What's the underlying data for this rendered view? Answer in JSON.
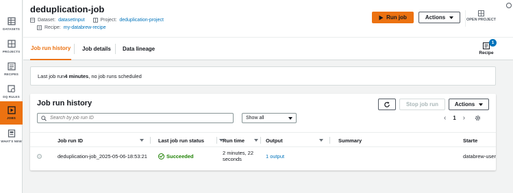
{
  "sidebar": {
    "items": [
      {
        "label": "DATASETS",
        "icon": "table-icon",
        "active": false
      },
      {
        "label": "PROJECTS",
        "icon": "grid-icon",
        "active": false
      },
      {
        "label": "RECIPES",
        "icon": "list-icon",
        "active": false
      },
      {
        "label": "DQ RULES",
        "icon": "shield-check-icon",
        "active": false
      },
      {
        "label": "JOBS",
        "icon": "play-icon",
        "active": true
      },
      {
        "label": "WHAT'S NEW",
        "icon": "news-icon",
        "active": false
      }
    ]
  },
  "header": {
    "title": "deduplication-job",
    "dataset_label": "Dataset:",
    "dataset_value": "datasetInput",
    "project_label": "Project:",
    "project_value": "deduplication-project",
    "recipe_label": "Recipe:",
    "recipe_value": "my-databrew-recipe",
    "run_job_label": "Run job",
    "actions_label": "Actions",
    "open_project_label": "OPEN PROJECT"
  },
  "tabs": [
    {
      "label": "Job run history",
      "active": true
    },
    {
      "label": "Job details",
      "active": false
    },
    {
      "label": "Data lineage",
      "active": false
    }
  ],
  "recipe_panel": {
    "label": "Recipe",
    "badge": "1"
  },
  "status": {
    "prefix": "Last job run ",
    "bold": "4 minutes",
    "suffix": ", no job runs scheduled"
  },
  "panel": {
    "title": "Job run history",
    "stop_label": "Stop job run",
    "actions_label": "Actions",
    "search_placeholder": "Search by job run ID",
    "filter_value": "Show all",
    "page": "1"
  },
  "table": {
    "columns": [
      "Job run ID",
      "Last job run status",
      "Run time",
      "Output",
      "Summary",
      "Starte"
    ],
    "rows": [
      {
        "id": "deduplication-job_2025-05-06-18:53:21",
        "status": "Succeeded",
        "run_time": "2 minutes, 22 seconds",
        "output": "1 output",
        "summary": "",
        "started": "databrew-user"
      }
    ]
  },
  "colors": {
    "accent": "#ec7211",
    "link": "#0073bb",
    "success": "#1d8102"
  }
}
